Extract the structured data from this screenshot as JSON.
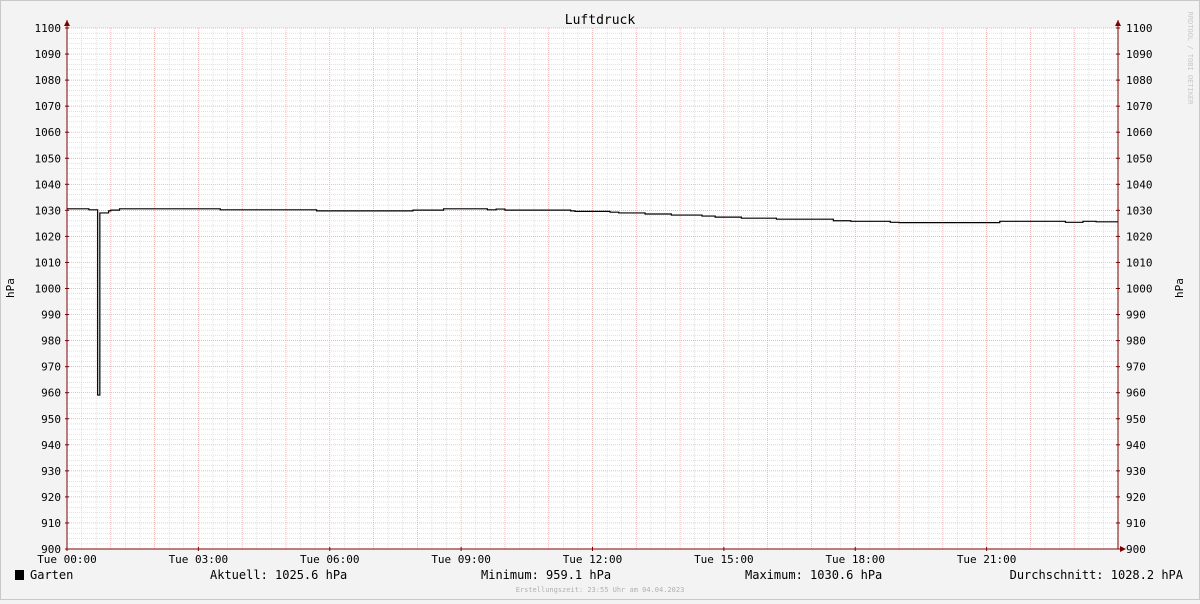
{
  "chart_data": {
    "type": "line",
    "title": "Luftdruck",
    "ylabel": "hPa",
    "ylabel_right": "hPa",
    "watermark": "RRDTOOL / TOBI OETIKER",
    "ylim": [
      900,
      1100
    ],
    "yticks": [
      900,
      910,
      920,
      930,
      940,
      950,
      960,
      970,
      980,
      990,
      1000,
      1010,
      1020,
      1030,
      1040,
      1050,
      1060,
      1070,
      1080,
      1090,
      1100
    ],
    "xlim": [
      0,
      24
    ],
    "xticks": [
      {
        "x": 0,
        "label": "Tue 00:00"
      },
      {
        "x": 3,
        "label": "Tue 03:00"
      },
      {
        "x": 6,
        "label": "Tue 06:00"
      },
      {
        "x": 9,
        "label": "Tue 09:00"
      },
      {
        "x": 12,
        "label": "Tue 12:00"
      },
      {
        "x": 15,
        "label": "Tue 15:00"
      },
      {
        "x": 18,
        "label": "Tue 18:00"
      },
      {
        "x": 21,
        "label": "Tue 21:00"
      }
    ],
    "grid": true,
    "series": [
      {
        "name": "Garten",
        "color": "#000000",
        "x": [
          0,
          0.5,
          0.5,
          0.7,
          0.7,
          0.75,
          0.75,
          0.95,
          0.95,
          1.0,
          1.0,
          1.2,
          1.2,
          3.5,
          3.5,
          5.7,
          5.7,
          7.9,
          7.9,
          8.6,
          8.6,
          9.6,
          9.6,
          9.8,
          9.8,
          10.0,
          10.0,
          11.5,
          11.5,
          11.6,
          11.6,
          12.4,
          12.4,
          12.6,
          12.6,
          13.2,
          13.2,
          13.8,
          13.8,
          14.5,
          14.5,
          14.8,
          14.8,
          15.4,
          15.4,
          16.2,
          16.2,
          17.5,
          17.5,
          17.9,
          17.9,
          18.8,
          18.8,
          19.0,
          19.0,
          21.3,
          21.3,
          22.8,
          22.8,
          23.2,
          23.2,
          23.5,
          23.5,
          24.0
        ],
        "values": [
          1030.6,
          1030.6,
          1030.2,
          1030.2,
          959.1,
          959.1,
          1029.0,
          1029.0,
          1029.8,
          1029.8,
          1030.1,
          1030.1,
          1030.6,
          1030.6,
          1030.2,
          1030.2,
          1029.8,
          1029.8,
          1030.1,
          1030.1,
          1030.6,
          1030.6,
          1030.2,
          1030.2,
          1030.5,
          1030.5,
          1030.1,
          1030.1,
          1029.8,
          1029.8,
          1029.6,
          1029.6,
          1029.3,
          1029.3,
          1029.0,
          1029.0,
          1028.6,
          1028.6,
          1028.2,
          1028.2,
          1027.8,
          1027.8,
          1027.4,
          1027.4,
          1027.0,
          1027.0,
          1026.6,
          1026.6,
          1026.0,
          1026.0,
          1025.8,
          1025.8,
          1025.4,
          1025.4,
          1025.3,
          1025.3,
          1025.8,
          1025.8,
          1025.4,
          1025.4,
          1025.8,
          1025.8,
          1025.6,
          1025.6
        ]
      }
    ]
  },
  "legend": {
    "series_name": "Garten",
    "aktuell": "Aktuell: 1025.6 hPa",
    "minimum": "Minimum: 959.1 hPa",
    "maximum": "Maximum: 1030.6 hPa",
    "durchschnitt": "Durchschnitt: 1028.2 hPA",
    "footer": "Erstellungszeit: 23:55 Uhr am 04.04.2023"
  },
  "colors": {
    "background": "#f3f3f3",
    "canvas": "#ffffff",
    "major_grid": "#e8a0a0",
    "minor_grid": "#cfcfcf",
    "axis": "#800000",
    "line": "#000000"
  }
}
